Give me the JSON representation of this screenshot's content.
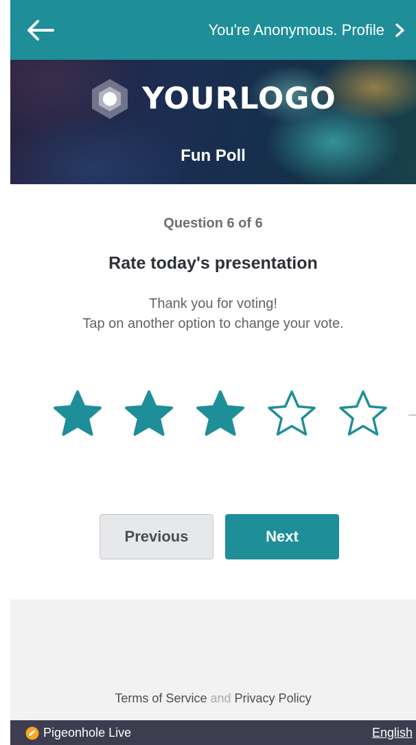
{
  "header": {
    "back_icon": "arrow-left-icon",
    "profile_link": "You're Anonymous. Profile",
    "profile_chevron_icon": "chevron-right-icon",
    "bar_color": "#1e8e98"
  },
  "banner": {
    "logo_text": "YOURLOGO",
    "logo_icon": "hexagon-logo-icon",
    "event_title": "Fun Poll"
  },
  "question": {
    "counter": "Question 6 of 6",
    "title": "Rate today's presentation",
    "thanks_line": "Thank you for voting!",
    "hint_line": "Tap on another option to change your vote."
  },
  "rating": {
    "max": 5,
    "value": 3,
    "star_icon": "star-icon",
    "color": "#1e8e98"
  },
  "navigation": {
    "previous_label": "Previous",
    "next_label": "Next"
  },
  "footer": {
    "terms": "Terms of Service",
    "and": "and",
    "privacy": "Privacy Policy",
    "brand": "Pigeonhole Live",
    "brand_icon": "pigeonhole-logo-icon",
    "language": "English"
  }
}
